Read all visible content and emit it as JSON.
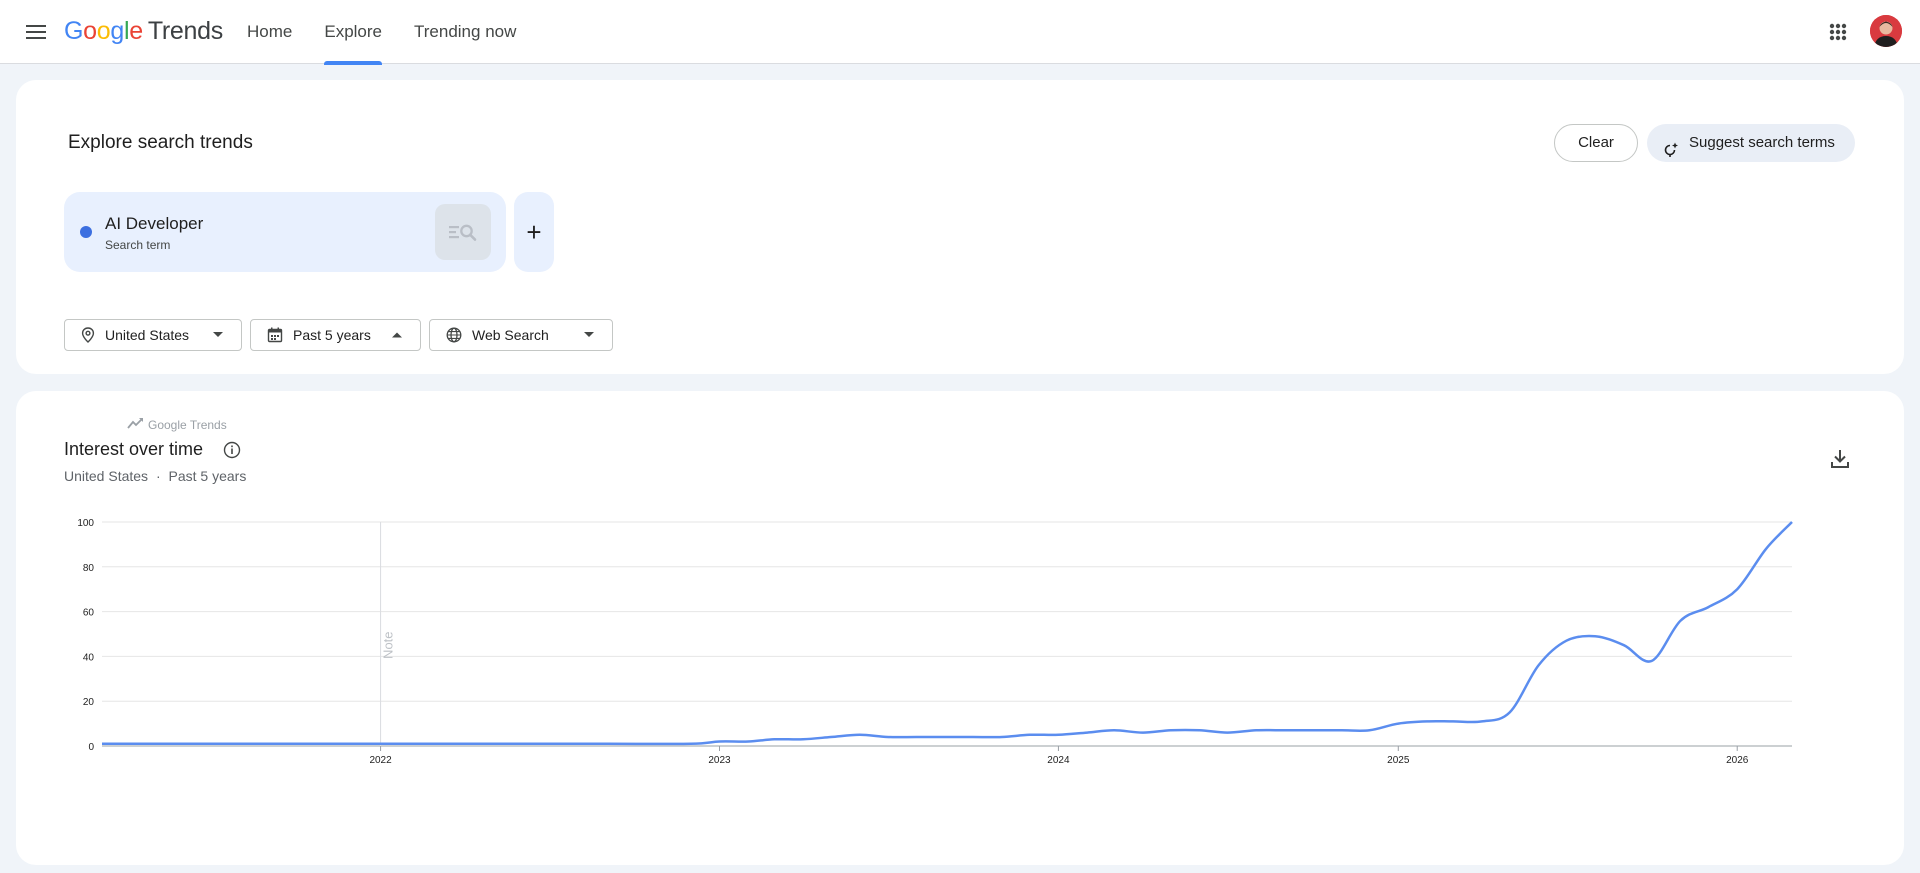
{
  "header": {
    "logo_google": [
      "G",
      "o",
      "o",
      "g",
      "l",
      "e"
    ],
    "logo_trends": "Trends",
    "nav": [
      {
        "label": "Home"
      },
      {
        "label": "Explore",
        "active": true
      },
      {
        "label": "Trending now"
      }
    ],
    "icons": {
      "menu": "hamburger-menu-icon",
      "apps": "apps-grid-icon",
      "avatar": "avatar"
    }
  },
  "explore": {
    "title": "Explore search trends",
    "clear_label": "Clear",
    "suggest_label": "Suggest search terms",
    "term": {
      "name": "AI Developer",
      "type": "Search term",
      "color": "#3c6fe0"
    },
    "add_label": "+",
    "filters": {
      "location": "United States",
      "time": "Past 5 years",
      "property": "Web Search"
    }
  },
  "interest": {
    "title": "Interest over time",
    "subtitle_location": "United States",
    "subtitle_sep": "·",
    "subtitle_time": "Past 5 years",
    "watermark": "Google Trends",
    "note_label": "Note"
  },
  "chart_data": {
    "type": "line",
    "title": "Interest over time",
    "xlabel": "",
    "ylabel": "",
    "ylim": [
      0,
      100
    ],
    "yticks": [
      0,
      20,
      40,
      60,
      80,
      100
    ],
    "xlim": [
      "2021-03-07",
      "2026-03-01"
    ],
    "xticks": [
      {
        "label": "2022",
        "date": "2022-01-01"
      },
      {
        "label": "2023",
        "date": "2023-01-01"
      },
      {
        "label": "2024",
        "date": "2024-01-01"
      },
      {
        "label": "2025",
        "date": "2025-01-01"
      },
      {
        "label": "2026",
        "date": "2026-01-01"
      }
    ],
    "grid": true,
    "legend": "none",
    "annotations": [
      {
        "label": "Note",
        "date": "2022-01-01"
      }
    ],
    "series": [
      {
        "color": "#5b8def",
        "x": [
          "2021-03-07",
          "2021-06-01",
          "2021-09-01",
          "2021-12-01",
          "2022-03-01",
          "2022-06-01",
          "2022-09-01",
          "2022-12-01",
          "2023-01-01",
          "2023-02-01",
          "2023-03-01",
          "2023-04-01",
          "2023-05-01",
          "2023-06-01",
          "2023-07-01",
          "2023-08-01",
          "2023-09-01",
          "2023-10-01",
          "2023-11-01",
          "2023-12-01",
          "2024-01-01",
          "2024-02-01",
          "2024-03-01",
          "2024-04-01",
          "2024-05-01",
          "2024-06-01",
          "2024-07-01",
          "2024-08-01",
          "2024-09-01",
          "2024-10-01",
          "2024-11-01",
          "2024-12-01",
          "2025-01-01",
          "2025-02-01",
          "2025-03-01",
          "2025-04-01",
          "2025-05-01",
          "2025-06-01",
          "2025-07-01",
          "2025-08-01",
          "2025-09-01",
          "2025-10-01",
          "2025-11-01",
          "2025-12-01",
          "2026-01-01",
          "2026-02-01",
          "2026-03-01"
        ],
        "y": [
          1,
          1,
          1,
          1,
          1,
          1,
          1,
          1,
          2,
          2,
          3,
          3,
          4,
          5,
          4,
          4,
          4,
          4,
          4,
          5,
          5,
          6,
          7,
          6,
          7,
          7,
          6,
          7,
          7,
          7,
          7,
          7,
          10,
          11,
          11,
          11,
          15,
          36,
          47,
          49,
          45,
          38,
          56,
          62,
          70,
          88,
          100
        ]
      }
    ]
  }
}
